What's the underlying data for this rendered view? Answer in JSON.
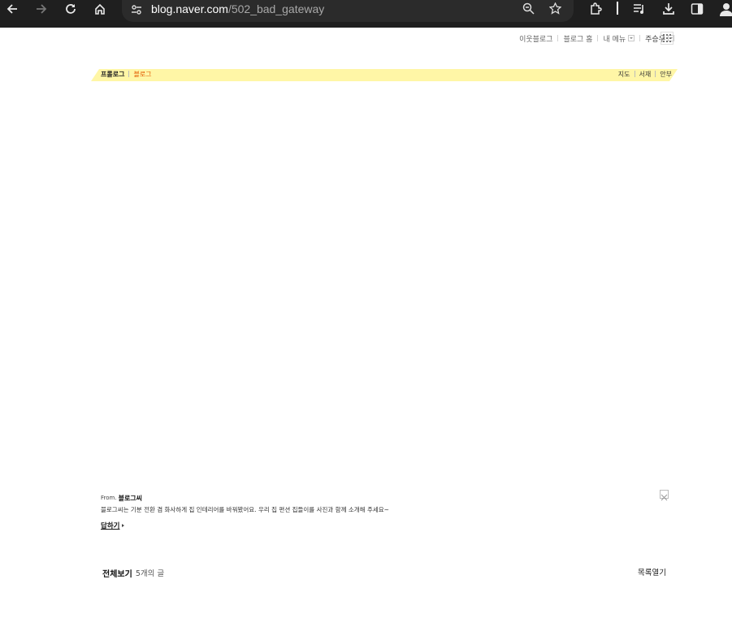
{
  "browser": {
    "url_host": "blog.naver.com",
    "url_path": "/502_bad_gateway"
  },
  "gnb": {
    "items": [
      "이웃블로그",
      "블로그 홈",
      "내 메뉴"
    ],
    "user": "주승우"
  },
  "blog_bar": {
    "prologue": "프롤로그",
    "blog": "블로그",
    "right_items": [
      "지도",
      "서재",
      "안부"
    ]
  },
  "notice": {
    "from_label": "From.",
    "from_name": "블로그씨",
    "message": "블로그씨는 기분 전환 겸 화사하게 집 인테리어를 바꿔봤어요. 우리 집 편션 집들이를 사진과 함께 소개해 주세요~",
    "reply_label": "답하기"
  },
  "post_list": {
    "all_label": "전체보기",
    "count_label": "5개의 글",
    "open_label": "목록열기"
  },
  "colors": {
    "chrome_bg": "#1f1f1f",
    "blog_bar": "#fff6a6",
    "blog_accent": "#e25a00"
  }
}
